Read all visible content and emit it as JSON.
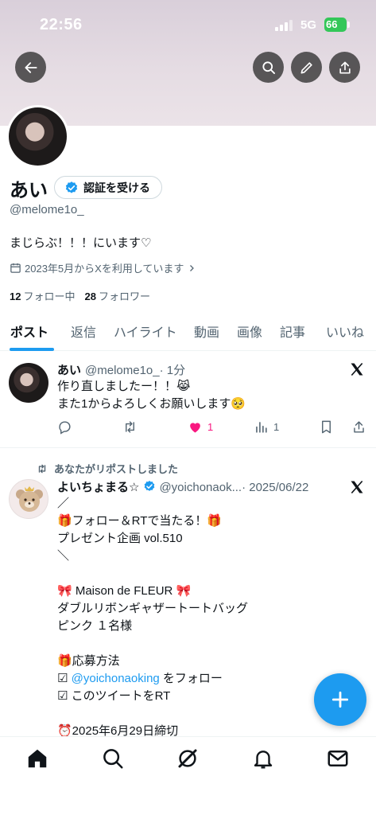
{
  "status_bar": {
    "time": "22:56",
    "network": "5G",
    "battery": "66"
  },
  "header": {
    "back_icon": "arrow-left-icon",
    "search_icon": "search-icon",
    "edit_icon": "pencil-icon",
    "share_icon": "share-icon"
  },
  "profile": {
    "name": "あい",
    "verify_label": "認証を受ける",
    "handle": "@melome1o_",
    "bio": "まじらぶ！！！にいます♡",
    "joined": "2023年5月からXを利用しています",
    "following_count": "12",
    "following_label": "フォロー中",
    "followers_count": "28",
    "followers_label": "フォロワー"
  },
  "tabs": [
    "ポスト",
    "返信",
    "ハイライト",
    "動画",
    "画像",
    "記事",
    "いいね"
  ],
  "posts": [
    {
      "name": "あい",
      "handle": "@melome1o_",
      "time": "· 1分",
      "line1": "作り直しましたー！！",
      "line1_emoji": "😹",
      "line2": "また1からよろしくお願いします",
      "line2_emoji": "🥺",
      "likes": "1",
      "views": "1"
    },
    {
      "repost_label": "あなたがリポストしました",
      "name": "よいちょまる☆",
      "handle": "@yoichonaok...",
      "date": "· 2025/06/22",
      "lines": [
        "／",
        "🎁フォロー＆RTで当たる！🎁",
        "プレゼント企画 vol.510",
        "＼",
        "",
        "🎀 Maison de FLEUR 🎀",
        "ダブルリボンギャザートートバッグ",
        "ピンク １名様",
        "",
        "🎁応募方法",
        "☑",
        "☑ このツイートをRT",
        "",
        "⏰2025年6月29日締切"
      ],
      "mention": "@yoichonaoking",
      "mention_suffix": " をフォロー"
    }
  ],
  "colors": {
    "accent": "#1d9bf0",
    "like": "#f91880",
    "text": "#0f1419",
    "muted": "#536471"
  }
}
